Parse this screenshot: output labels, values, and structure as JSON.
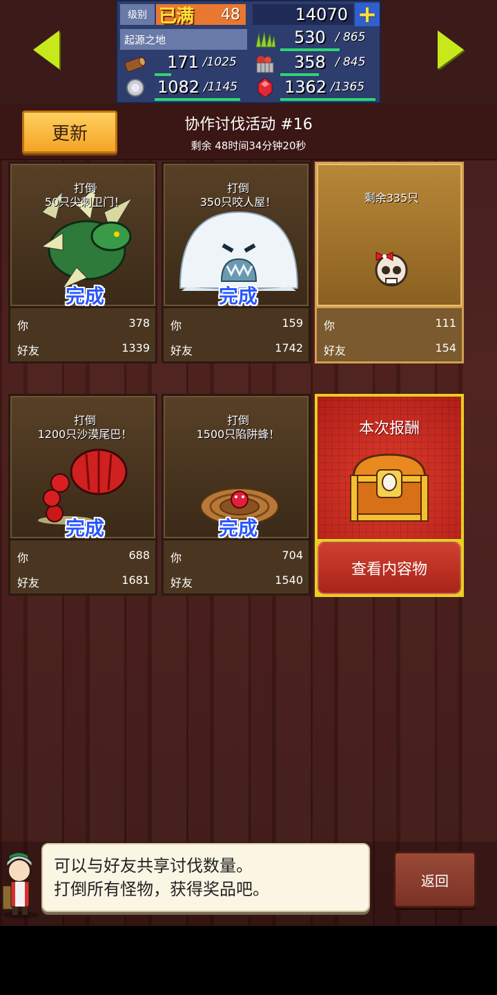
{
  "topbar": {
    "level_label": "级别",
    "level_max": "已满",
    "level_value": "48",
    "gems": "14070",
    "plus": "+",
    "location": "起源之地",
    "grass_value": "530",
    "grass_max": "/ 865",
    "wood_value": "171",
    "wood_max": "/1025",
    "food_value": "358",
    "food_max": "/ 845",
    "ore_value": "1082",
    "ore_max": "/1145",
    "ruby_value": "1362",
    "ruby_max": "/1365",
    "accent_bar_color": "#2ed573"
  },
  "header": {
    "refresh_label": "更新",
    "event_title": "协作讨伐活动 #16",
    "time_remaining": "剩余 48时间34分钟20秒"
  },
  "labels": {
    "you": "你",
    "friends": "好友",
    "done": "完成"
  },
  "cards": [
    {
      "task_line1": "打倒",
      "task_line2": "50只尖刺卫门！",
      "you": "378",
      "friends": "1339",
      "status": "done",
      "monster_icon": "dragon-icon"
    },
    {
      "task_line1": "打倒",
      "task_line2": "350只咬人屋！",
      "you": "159",
      "friends": "1742",
      "status": "done",
      "monster_icon": "snow-monster-icon"
    },
    {
      "task_line1": "剩余335只",
      "task_line2": "",
      "you": "111",
      "friends": "154",
      "status": "active",
      "monster_icon": "skull-icon"
    },
    {
      "task_line1": "打倒",
      "task_line2": "1200只沙漠尾巴！",
      "you": "688",
      "friends": "1681",
      "status": "done",
      "monster_icon": "scorpion-tail-icon"
    },
    {
      "task_line1": "打倒",
      "task_line2": "1500只陷阱蜂！",
      "you": "704",
      "friends": "1540",
      "status": "done",
      "monster_icon": "antlion-trap-icon"
    }
  ],
  "reward": {
    "title": "本次报酬",
    "button_label": "查看内容物",
    "chest_icon": "treasure-chest-icon"
  },
  "dialog": {
    "line1": "可以与好友共享讨伐数量。",
    "line2": "打倒所有怪物，获得奖品吧。"
  },
  "back_label": "返回"
}
